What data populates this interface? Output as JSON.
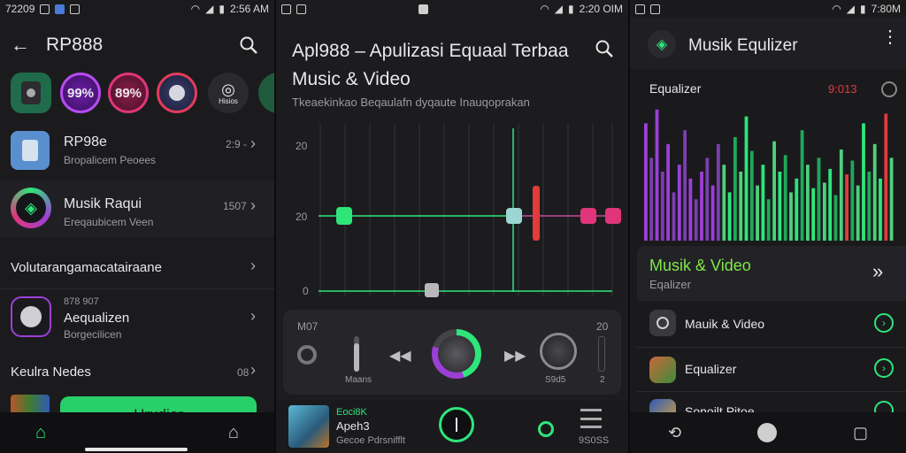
{
  "panel1": {
    "status": {
      "time": "72209",
      "clock": "2:56 AM"
    },
    "header": {
      "title": "RP888"
    },
    "chips": [
      {
        "label": ""
      },
      {
        "label": "99%"
      },
      {
        "label": "89%"
      },
      {
        "label": ""
      },
      {
        "label": "Hisios"
      }
    ],
    "list": [
      {
        "title": "RP98e",
        "subtitle": "Bropalicem Peoees",
        "meta": "2:9 -"
      },
      {
        "title": "Musik Raqui",
        "subtitle": "Ereqaubicem Veen",
        "meta": "1507"
      },
      {
        "title": "Volutarangamacatairaane",
        "subtitle": "",
        "meta": ""
      },
      {
        "title": "Aequalizen",
        "subtitle": "Borgecilicen",
        "meta": "",
        "top": "878 907"
      },
      {
        "title": "Keulra Nedes",
        "subtitle": "",
        "meta": "08"
      }
    ],
    "cta": "Hrudier"
  },
  "panel2": {
    "status": {
      "clock": "2:20 OIM"
    },
    "title": "Apl988 – Apulizasi Equaal Terbaa Music & Video",
    "subtitle": "Tkeaekinkao Beqaulafn dyqaute Inauqoprakan",
    "eq": {
      "y_labels": [
        "20",
        "20",
        "0"
      ]
    },
    "controls": {
      "left_label": "M07",
      "right_label": "20",
      "vol_label": "Maans",
      "knob_label": "S9d5",
      "small_label": "2"
    },
    "now_playing": {
      "line1": "Eoci8K",
      "line2": "Apeh3",
      "line3": "Gecoe Pdrsnifflt",
      "right_label": "9S0SS"
    }
  },
  "panel3": {
    "status": {
      "clock": "7:80M"
    },
    "header": {
      "title": "Musik Equlizer"
    },
    "eq_label": "Equalizer",
    "eq_value": "9:013",
    "section": {
      "title": "Musik & Video",
      "subtitle": "Eqalizer"
    },
    "items": [
      {
        "label": "Mauik & Video"
      },
      {
        "label": "Equalizer"
      },
      {
        "label": "Sonoilt Pitoe"
      }
    ]
  },
  "colors": {
    "green": "#2ee57a",
    "purple": "#9c3fd6",
    "pink": "#e0357a",
    "red": "#e23b3b"
  }
}
